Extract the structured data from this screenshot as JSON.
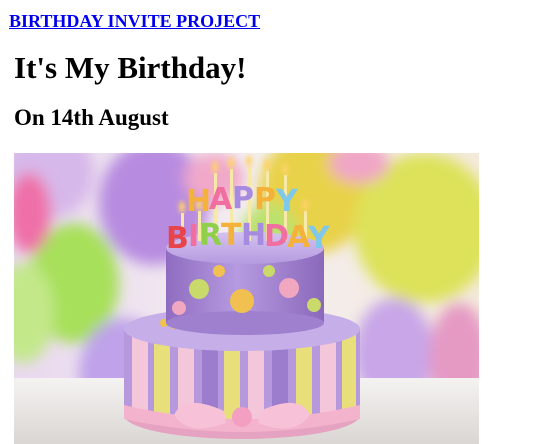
{
  "header": {
    "project_link": "BIRTHDAY INVITE PROJECT"
  },
  "main": {
    "title": "It's My Birthday!",
    "date_heading": "On 14th August",
    "cake_image": {
      "candle_letters_row1": "HAPPY",
      "candle_letters_row2": "BIRTHDAY",
      "alt": "Birthday cake with HAPPY BIRTHDAY candles and balloons"
    }
  },
  "colors": {
    "link": "#0000ee",
    "text": "#000000",
    "cake_top": "#a98bd3",
    "cake_bottom_stripes": [
      "#f2c4d8",
      "#e8e07a",
      "#b79be0",
      "#f5a7c4"
    ],
    "ribbon": "#f7b8cf",
    "dots": [
      "#c9d96a",
      "#f2a7c0",
      "#f0c050"
    ]
  }
}
